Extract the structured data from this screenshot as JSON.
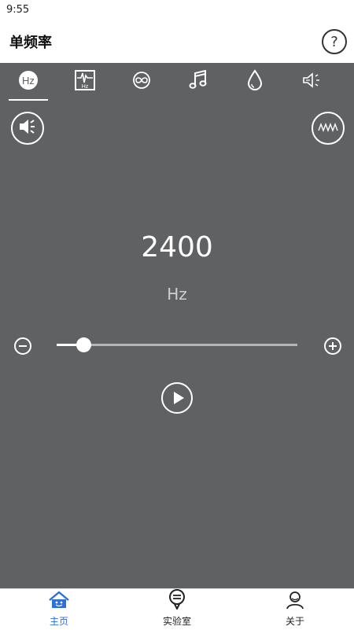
{
  "status": {
    "time": "9:55"
  },
  "appbar": {
    "title": "单频率",
    "help_icon": "help-circle-icon"
  },
  "tabs": [
    {
      "id": "hz",
      "icon": "hz-tone-icon",
      "selected": true
    },
    {
      "id": "sweep",
      "icon": "hz-waveform-icon",
      "selected": false
    },
    {
      "id": "loop",
      "icon": "infinity-loop-icon",
      "selected": false
    },
    {
      "id": "music",
      "icon": "music-note-icon",
      "selected": false
    },
    {
      "id": "water",
      "icon": "water-drop-icon",
      "selected": false
    },
    {
      "id": "speaker-clean",
      "icon": "speaker-vibration-icon",
      "selected": false
    }
  ],
  "controls": {
    "speaker_icon": "speaker-volume-icon",
    "wave_icon": "sine-wave-icon"
  },
  "frequency": {
    "value": "2400",
    "unit": "Hz",
    "slider_fraction": 0.11
  },
  "colors": {
    "panel_bg": "#606163",
    "accent": "#2f6fd8"
  },
  "bottom_nav": [
    {
      "label": "主页",
      "icon": "home-icon",
      "active": true
    },
    {
      "label": "实验室",
      "icon": "lab-icon",
      "active": false
    },
    {
      "label": "关于",
      "icon": "user-icon",
      "active": false
    }
  ]
}
